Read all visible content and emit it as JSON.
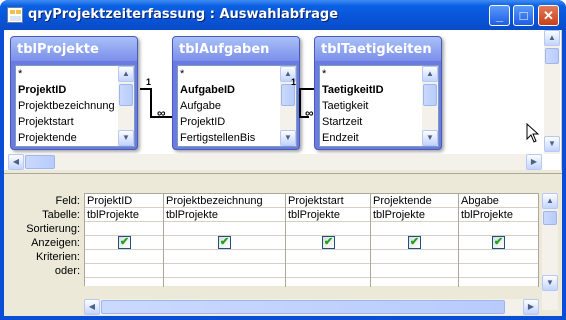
{
  "window": {
    "title": "qryProjektzeiterfassung : Auswahlabfrage",
    "buttons": {
      "minimize": "_",
      "maximize": "□",
      "close": "✕"
    }
  },
  "tables": [
    {
      "name": "tblProjekte",
      "fields": [
        "*",
        "ProjektID",
        "Projektbezeichnung",
        "Projektstart",
        "Projektende"
      ],
      "key_field": "ProjektID"
    },
    {
      "name": "tblAufgaben",
      "fields": [
        "*",
        "AufgabeID",
        "Aufgabe",
        "ProjektID",
        "FertigstellenBis"
      ],
      "key_field": "AufgabeID"
    },
    {
      "name": "tblTaetigkeiten",
      "fields": [
        "*",
        "TaetigkeitID",
        "Taetigkeit",
        "Startzeit",
        "Endzeit"
      ],
      "key_field": "TaetigkeitID"
    }
  ],
  "relationships": [
    {
      "one_label": "1",
      "many_label": "∞"
    },
    {
      "one_label": "1",
      "many_label": "∞"
    }
  ],
  "qbe": {
    "row_labels": [
      "Feld:",
      "Tabelle:",
      "Sortierung:",
      "Anzeigen:",
      "Kriterien:",
      "oder:"
    ],
    "columns": [
      {
        "feld": "ProjektID",
        "tabelle": "tblProjekte",
        "anzeigen": true
      },
      {
        "feld": "Projektbezeichnung",
        "tabelle": "tblProjekte",
        "anzeigen": true
      },
      {
        "feld": "Projektstart",
        "tabelle": "tblProjekte",
        "anzeigen": true
      },
      {
        "feld": "Projektende",
        "tabelle": "tblProjekte",
        "anzeigen": true
      },
      {
        "feld": "Abgabe",
        "tabelle": "tblProjekte",
        "anzeigen": true
      }
    ]
  },
  "icons": {
    "check": "✔",
    "arrow_up": "▲",
    "arrow_down": "▼",
    "arrow_left": "◀",
    "arrow_right": "▶"
  },
  "colors": {
    "titlebar": "#0a5fe3",
    "table_header": "#7b8fe9",
    "check": "#21a121"
  }
}
